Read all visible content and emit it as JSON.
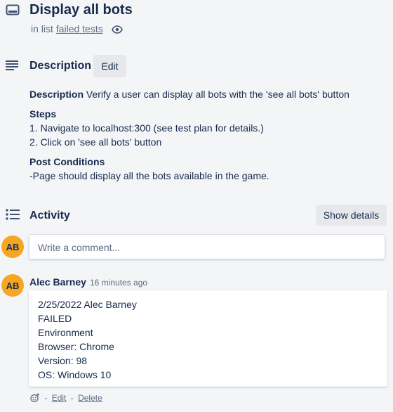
{
  "card": {
    "title": "Display all bots",
    "list_prefix": "in list",
    "list_name": "failed tests"
  },
  "description": {
    "heading": "Description",
    "edit_label": "Edit",
    "desc_label": "Description",
    "desc_text": " Verify a user can display all bots with the 'see all bots' button",
    "steps_label": "Steps",
    "steps": [
      "1. Navigate to localhost:300 (see test plan for details.)",
      "2. Click on 'see all bots' button"
    ],
    "post_label": "Post Conditions",
    "post_text": "-Page should display all the bots available in the game."
  },
  "activity": {
    "heading": "Activity",
    "show_details_label": "Show details",
    "comment_placeholder": "Write a comment...",
    "user_initials": "AB"
  },
  "comment": {
    "initials": "AB",
    "author": "Alec Barney",
    "time": "16 minutes ago",
    "lines": [
      "2/25/2022 Alec Barney",
      "FAILED",
      "Environment",
      "Browser: Chrome",
      "Version: 98",
      "OS: Windows 10"
    ],
    "separator": "-",
    "edit_label": "Edit",
    "delete_label": "Delete"
  },
  "colors": {
    "background": "#f4f5f7",
    "avatar": "#f5a623",
    "text": "#172b4d",
    "muted": "#5e6c84"
  }
}
